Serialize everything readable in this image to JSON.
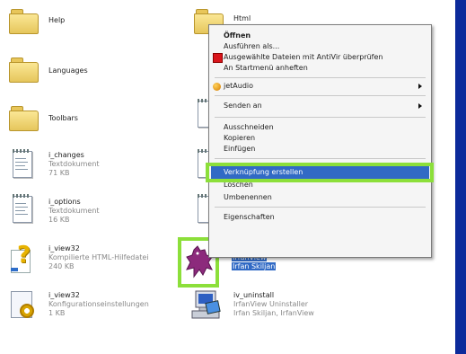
{
  "files": {
    "help": {
      "name": "Help"
    },
    "languages": {
      "name": "Languages"
    },
    "toolbars": {
      "name": "Toolbars"
    },
    "i_changes": {
      "name": "i_changes",
      "type": "Textdokument",
      "size": "71 KB"
    },
    "i_options": {
      "name": "i_options",
      "type": "Textdokument",
      "size": "16 KB"
    },
    "i_view32_chm": {
      "name": "i_view32",
      "type": "Kompilierte HTML-Hilfedatei",
      "size": "240 KB"
    },
    "i_view32_ini": {
      "name": "i_view32",
      "type": "Konfigurationseinstellungen",
      "size": "1 KB"
    },
    "html": {
      "name": "Html"
    },
    "irfanview": {
      "line1": "IrfanView",
      "line2": "Irfan Skiljan"
    },
    "iv_uninstall": {
      "name": "iv_uninstall",
      "desc": "IrfanView Uninstaller",
      "company": "Irfan Skiljan, IrfanView"
    }
  },
  "context_menu": {
    "items": [
      {
        "label": "Öffnen",
        "bold": true
      },
      {
        "label": "Ausführen als..."
      },
      {
        "label": "Ausgewählte Dateien mit AntiVir überprüfen",
        "icon": "antivir-icon"
      },
      {
        "label": "An Startmenü anheften"
      },
      {
        "label": "jetAudio",
        "icon": "jetaudio-icon",
        "submenu": true
      },
      {
        "label": "Senden an",
        "submenu": true
      },
      {
        "label": "Ausschneiden"
      },
      {
        "label": "Kopieren"
      },
      {
        "label": "Einfügen"
      },
      {
        "label": "Verknüpfung erstellen",
        "highlighted": true
      },
      {
        "label": "Löschen"
      },
      {
        "label": "Umbenennen"
      },
      {
        "label": "Eigenschaften"
      }
    ]
  },
  "colors": {
    "highlight": "#316ac5",
    "annotation_green": "#8cdf3a",
    "folder": "#f3d36f"
  }
}
